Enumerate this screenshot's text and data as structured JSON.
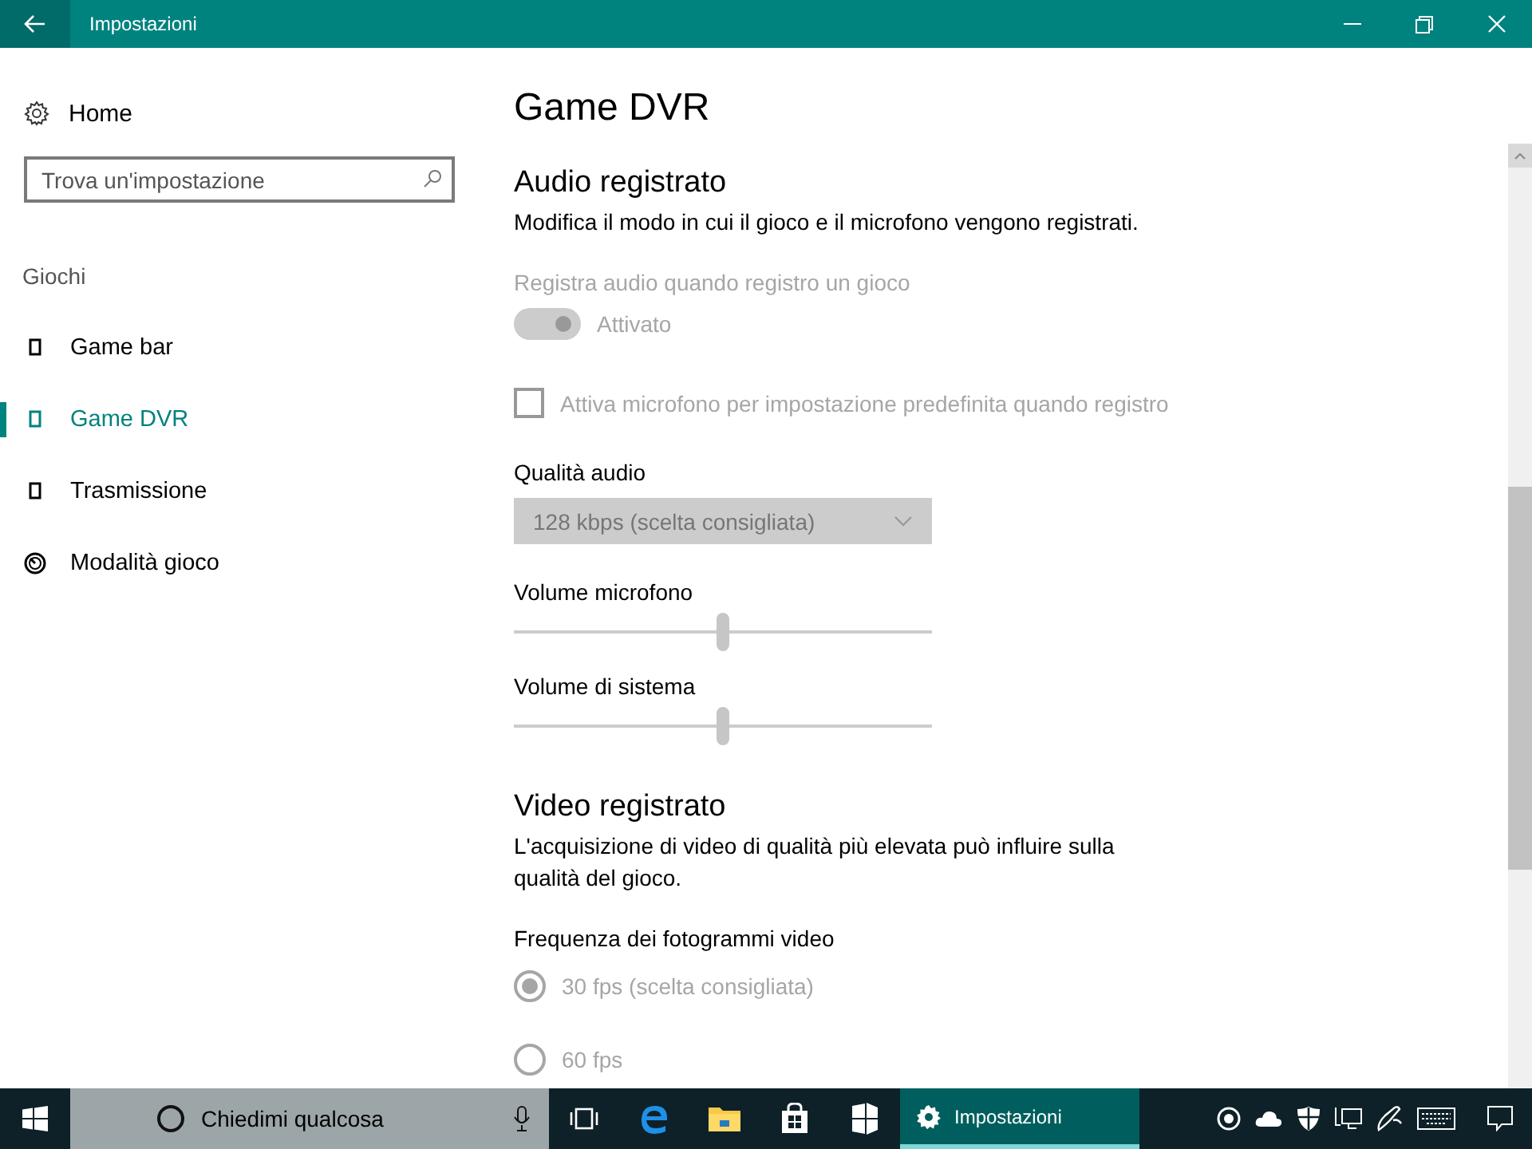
{
  "window": {
    "title": "Impostazioni"
  },
  "sidebar": {
    "home": "Home",
    "search": {
      "placeholder": "Trova un'impostazione"
    },
    "group": "Giochi",
    "items": [
      {
        "label": "Game bar",
        "selected": false
      },
      {
        "label": "Game DVR",
        "selected": true
      },
      {
        "label": "Trasmissione",
        "selected": false
      },
      {
        "label": "Modalità gioco",
        "selected": false
      }
    ]
  },
  "content": {
    "title": "Game DVR",
    "sections": [
      {
        "heading": "Audio registrato",
        "description": "Modifica il modo in cui il gioco e il microfono vengono registrati.",
        "controls": [
          {
            "kind": "toggle",
            "label": "Registra audio quando registro un gioco",
            "on": true,
            "state_text": "Attivato",
            "disabled": true
          },
          {
            "kind": "checkbox",
            "label": "Attiva microfono per impostazione predefinita quando registro",
            "checked": false,
            "disabled": true
          },
          {
            "kind": "dropdown",
            "label": "Qualità audio",
            "value": "128 kbps (scelta consigliata)",
            "disabled": true
          },
          {
            "kind": "slider",
            "label": "Volume microfono",
            "level": 0.5
          },
          {
            "kind": "slider",
            "label": "Volume di sistema",
            "level": 0.5
          }
        ]
      },
      {
        "heading": "Video registrato",
        "description": "L'acquisizione di video di qualità più elevata può influire sulla qualità del gioco.",
        "controls": [
          {
            "kind": "radio_group",
            "label": "Frequenza dei fotogrammi video",
            "options": [
              {
                "label": "30 fps (scelta consigliata)",
                "selected": true,
                "disabled": true
              },
              {
                "label": "60 fps",
                "selected": false,
                "disabled": true
              }
            ]
          }
        ]
      }
    ]
  },
  "taskbar": {
    "search": {
      "placeholder": "Chiedimi qualcosa"
    },
    "running_app": {
      "label": "Impostazioni",
      "active": true
    }
  }
}
